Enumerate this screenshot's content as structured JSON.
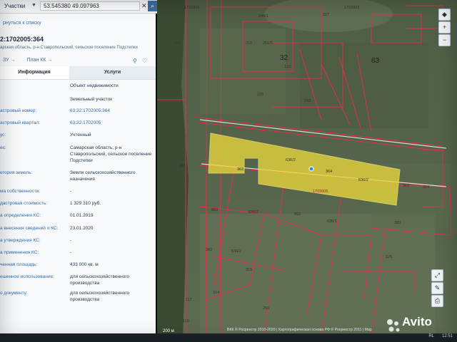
{
  "search": {
    "category": "Участки",
    "query": "53.545380 49.097963"
  },
  "panel": {
    "back_link": "рнуться к списку",
    "cadastral_number": "2:1702005:364",
    "address": "арская область, р-н Ставропольский, сельское поселение Подстепки",
    "link_1": "ЗУ →",
    "link_2": "План КК →",
    "tab_info": "Информация",
    "tab_services": "Услуги",
    "rows": [
      {
        "label": "",
        "value": "Объект недвижимости"
      },
      {
        "label": "",
        "value": "Земельный участок"
      },
      {
        "label": "астровый номер:",
        "value": "63:32:1702005:364"
      },
      {
        "label": "астровый квартал:",
        "value": "63:32:1702005"
      },
      {
        "label": "ус:",
        "value": "Учтенный"
      },
      {
        "label": "ес:",
        "value": "Самарская область, р-н Ставропольский, сельское поселение Подстепки"
      },
      {
        "label": "егория земель:",
        "value": "Земли сельскохозяйственного назначения"
      },
      {
        "label": "ма собственности:",
        "value": "-"
      },
      {
        "label": "дастровая стоимость:",
        "value": "1 329 310 руб."
      },
      {
        "label": "а определения КС:",
        "value": "01.01.2019"
      },
      {
        "label": "а внесения сведений о КС:",
        "value": "23.01.2020"
      },
      {
        "label": "а утверждения КС:",
        "value": "-"
      },
      {
        "label": "а применения КС:",
        "value": "-"
      },
      {
        "label": "ченная площадь:",
        "value": "433 000 кв. м"
      },
      {
        "label": "ешенное использование:",
        "value": "для сельскохозяйственного производства"
      },
      {
        "label": "о документу:",
        "value": "для сельскохозяйственного производства"
      }
    ]
  },
  "map": {
    "labels": [
      {
        "text": "1702004"
      },
      {
        "text": "1702002"
      },
      {
        "text": "227"
      },
      {
        "text": "246/1"
      },
      {
        "text": "210"
      },
      {
        "text": "251/9"
      },
      {
        "text": "107"
      },
      {
        "text": "32"
      },
      {
        "text": "63"
      },
      {
        "text": "225"
      },
      {
        "text": "110"
      },
      {
        "text": "243"
      },
      {
        "text": "636/2"
      },
      {
        "text": "363"
      },
      {
        "text": "364"
      },
      {
        "text": "636/2"
      },
      {
        "text": "1702005"
      },
      {
        "text": "103"
      },
      {
        "text": "636/2"
      },
      {
        "text": "860"
      },
      {
        "text": "552"
      },
      {
        "text": "636/1"
      },
      {
        "text": "636/2"
      },
      {
        "text": "314"
      },
      {
        "text": "315"
      },
      {
        "text": "260"
      },
      {
        "text": "117"
      },
      {
        "text": "119"
      },
      {
        "text": "256"
      },
      {
        "text": "325"
      },
      {
        "text": "324"
      },
      {
        "text": "363"
      },
      {
        "text": "300"
      }
    ],
    "scale": "200 м",
    "copyright": "ВКК © Росреестр 2010-2020 | Картографическая основа РФ © Росреестр 2011 | Map"
  },
  "watermark": "Avito",
  "taskbar": {
    "tray": "RL",
    "time": "12:51"
  }
}
